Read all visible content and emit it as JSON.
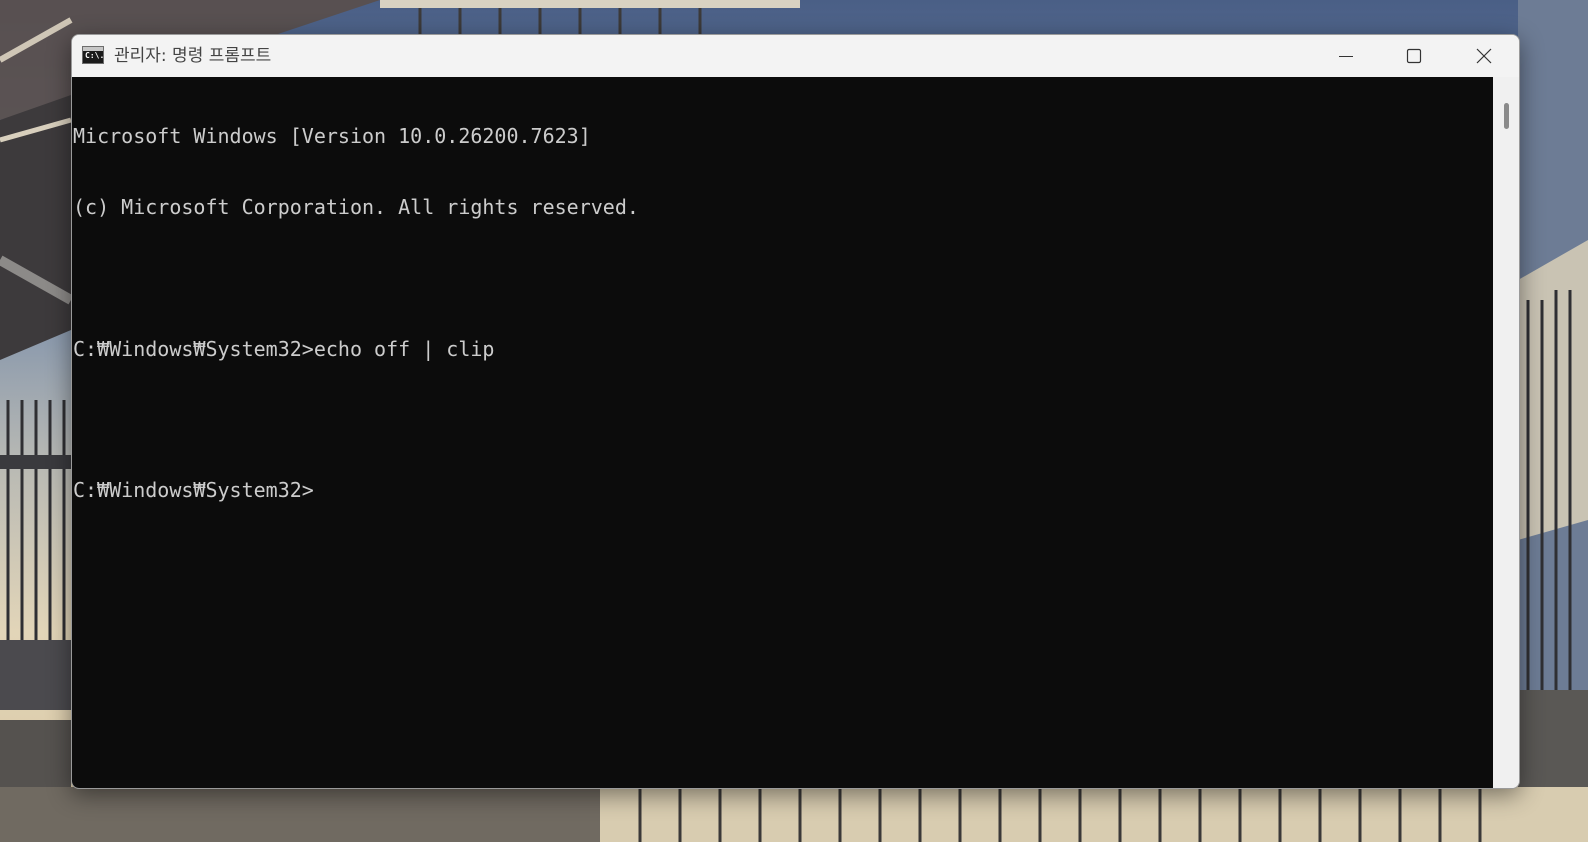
{
  "window": {
    "title": "관리자: 명령 프롬프트",
    "icon": "cmd-icon",
    "icon_text": "C:\\.",
    "controls": [
      "minimize-icon",
      "maximize-icon",
      "close-icon"
    ]
  },
  "console": {
    "lines": [
      "Microsoft Windows [Version 10.0.26200.7623]",
      "(c) Microsoft Corporation. All rights reserved.",
      "",
      "C:₩Windows₩System32>echo off | clip",
      "",
      "C:₩Windows₩System32>"
    ],
    "background": "#0c0c0c",
    "foreground": "#cccccc"
  },
  "colors": {
    "titlebar": "#f3f3f3",
    "title_text": "#444444"
  }
}
